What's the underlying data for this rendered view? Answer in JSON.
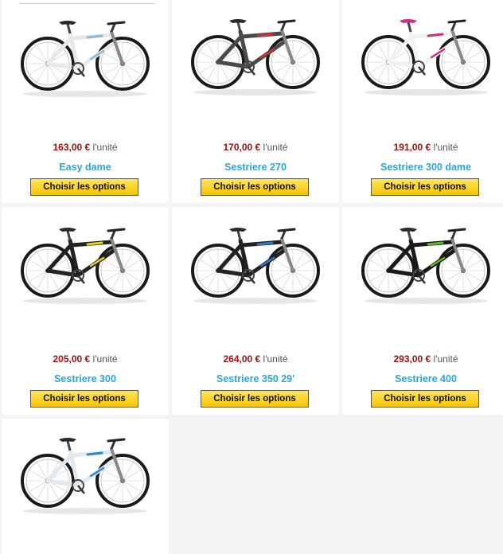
{
  "colors": {
    "price": "#a01010",
    "product_name": "#2aa7d9",
    "button_top": "#ffe55c",
    "button_bottom": "#f7c400",
    "page_background": "#f4f4f4"
  },
  "products": [
    {
      "price": "163,00 €",
      "unit": "l'unité",
      "name": "Easy dame",
      "button": "Choisir les options",
      "frame_color": "#e8e8e8",
      "accent": "#8ab8d8"
    },
    {
      "price": "170,00 €",
      "unit": "l'unité",
      "name": "Sestriere 270",
      "button": "Choisir les options",
      "frame_color": "#4a4a4a",
      "accent": "#d03030"
    },
    {
      "price": "191,00 €",
      "unit": "l'unité",
      "name": "Sestriere 300 dame",
      "button": "Choisir les options",
      "frame_color": "#f2f2f2",
      "accent": "#c8308a"
    },
    {
      "price": "205,00 €",
      "unit": "l'unité",
      "name": "Sestriere 300",
      "button": "Choisir les options",
      "frame_color": "#222222",
      "accent": "#e6d020"
    },
    {
      "price": "264,00 €",
      "unit": "l'unité",
      "name": "Sestriere 350 29'",
      "button": "Choisir les options",
      "frame_color": "#222222",
      "accent": "#2a7ac8"
    },
    {
      "price": "293,00 €",
      "unit": "l'unité",
      "name": "Sestriere 400",
      "button": "Choisir les options",
      "frame_color": "#1a1a1a",
      "accent": "#5ab82a"
    },
    {
      "frame_color": "#dfe9ee",
      "accent": "#2a8ac8"
    }
  ]
}
